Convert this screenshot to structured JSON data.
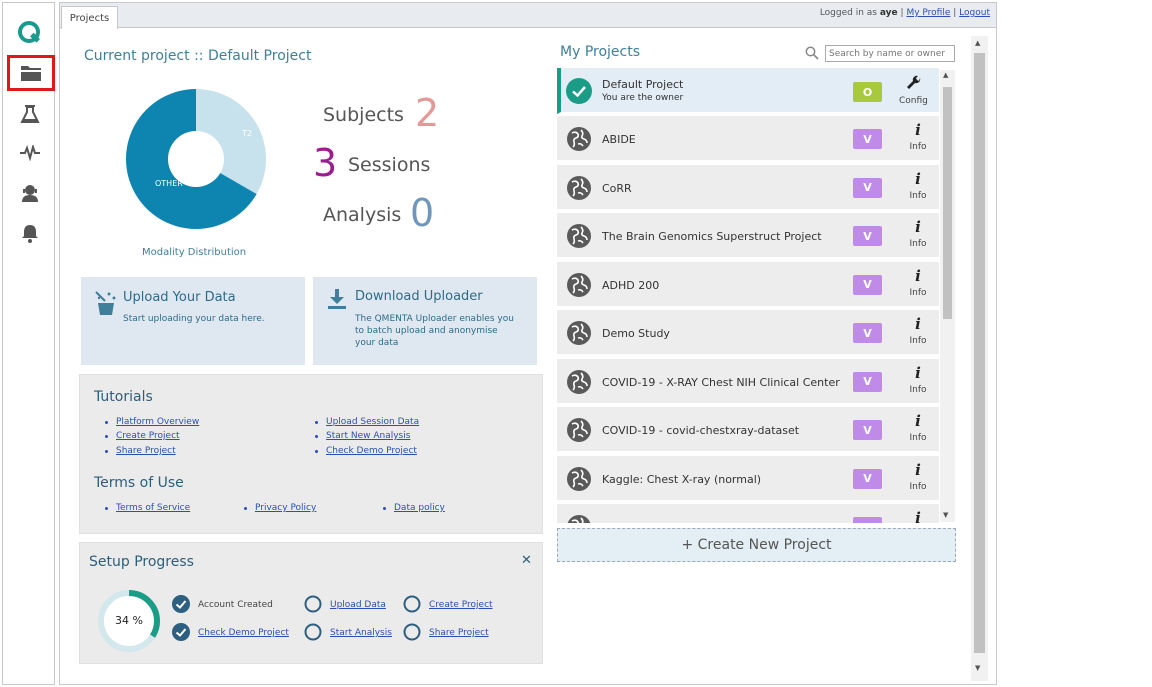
{
  "sidebar": {
    "logo": "Q",
    "items": [
      {
        "icon": "folder-icon",
        "selected": true
      },
      {
        "icon": "flask-icon",
        "selected": false
      },
      {
        "icon": "pulse-icon",
        "selected": false
      },
      {
        "icon": "user-support-icon",
        "selected": false
      },
      {
        "icon": "bell-icon",
        "selected": false
      }
    ]
  },
  "tabs": {
    "projects": "Projects"
  },
  "user": {
    "logged_in_as": "Logged in as",
    "username": "aye",
    "separator": "|",
    "my_profile": "My Profile",
    "logout": "Logout"
  },
  "current_project": {
    "title": "Current project :: Default Project",
    "chart": {
      "caption": "Modality Distribution",
      "slices": [
        {
          "label": "OTHER",
          "value": 2,
          "color": "#0e85b1"
        },
        {
          "label": "T2",
          "value": 1,
          "color": "#c7e2ec"
        }
      ]
    },
    "stats": {
      "subjects_label": "Subjects",
      "subjects_value": "2",
      "sessions_label": "Sessions",
      "sessions_value": "3",
      "analysis_label": "Analysis",
      "analysis_value": "0"
    },
    "colors": {
      "subjects": "#e59898",
      "sessions": "#9b1e8f",
      "analysis": "#6f97bb"
    }
  },
  "actions": {
    "upload_title": "Upload Your Data",
    "upload_desc": "Start uploading your data here.",
    "download_title": "Download Uploader",
    "download_desc_1": "The QMENTA Uploader enables you",
    "download_desc_2": "to batch upload and anonymise",
    "download_desc_3": "your data"
  },
  "tutorials": {
    "title": "Tutorials",
    "links": [
      "Platform Overview",
      "Create Project",
      "Share Project",
      "Upload Session Data",
      "Start New Analysis",
      "Check Demo Project"
    ]
  },
  "terms": {
    "title": "Terms of Use",
    "links": [
      "Terms of Service",
      "Privacy Policy",
      "Data policy"
    ]
  },
  "setup": {
    "title": "Setup Progress",
    "progress_text": "34 %",
    "progress_value": 0.34,
    "close": "✕",
    "steps": [
      {
        "label": "Account Created",
        "done": true,
        "link": false
      },
      {
        "label": "Check Demo Project",
        "done": true,
        "link": true
      },
      {
        "label": "Upload Data",
        "done": false,
        "link": true
      },
      {
        "label": "Start Analysis",
        "done": false,
        "link": true
      },
      {
        "label": "Create Project",
        "done": false,
        "link": true
      },
      {
        "label": "Share Project",
        "done": false,
        "link": true
      }
    ]
  },
  "my_projects": {
    "title": "My Projects",
    "search_placeholder": "Search by name or owner",
    "owner_row": {
      "name": "Default Project",
      "subtitle": "You are the owner",
      "badge": "O",
      "action": "Config",
      "badge_color": "#a9c93c"
    },
    "rows": [
      {
        "name": "ABIDE",
        "badge": "V",
        "action": "Info"
      },
      {
        "name": "CoRR",
        "badge": "V",
        "action": "Info"
      },
      {
        "name": "The Brain Genomics Superstruct Project",
        "badge": "V",
        "action": "Info"
      },
      {
        "name": "ADHD 200",
        "badge": "V",
        "action": "Info"
      },
      {
        "name": "Demo Study",
        "badge": "V",
        "action": "Info"
      },
      {
        "name": "COVID-19 - X-RAY Chest NIH Clinical Center",
        "badge": "V",
        "action": "Info"
      },
      {
        "name": "COVID-19 - covid-chestxray-dataset",
        "badge": "V",
        "action": "Info"
      },
      {
        "name": "Kaggle: Chest X-ray (normal)",
        "badge": "V",
        "action": "Info"
      }
    ],
    "create_label": "+ Create New Project"
  }
}
